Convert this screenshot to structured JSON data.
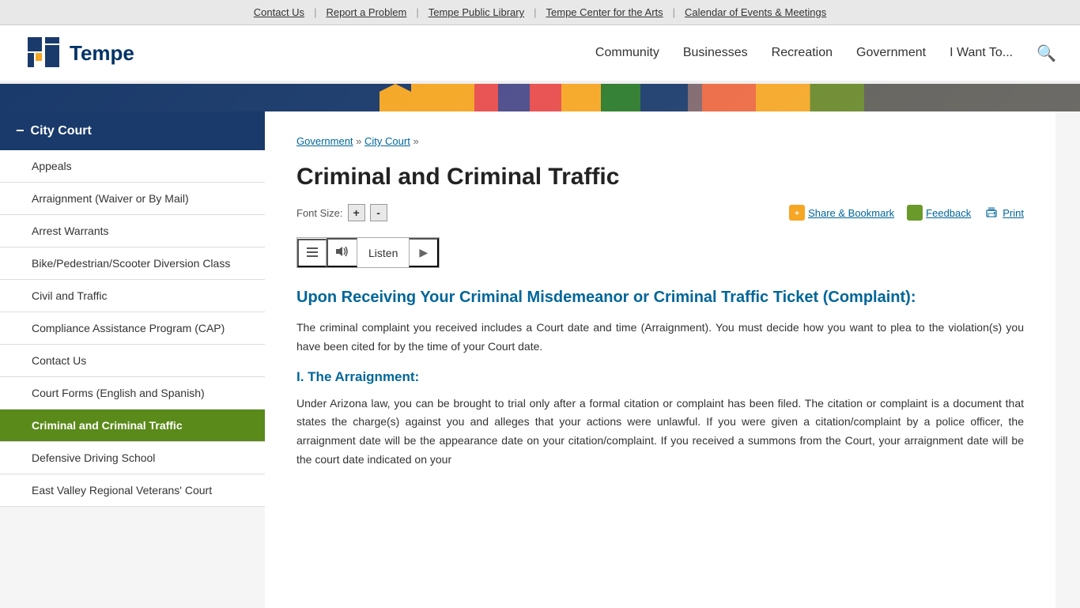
{
  "utility": {
    "links": [
      {
        "label": "Contact Us",
        "id": "util-contact"
      },
      {
        "label": "Report a Problem",
        "id": "util-report"
      },
      {
        "label": "Tempe Public Library",
        "id": "util-library"
      },
      {
        "label": "Tempe Center for the Arts",
        "id": "util-arts"
      },
      {
        "label": "Calendar of Events & Meetings",
        "id": "util-calendar"
      }
    ]
  },
  "header": {
    "logo_text": "Tempe",
    "nav_items": [
      {
        "label": "Community"
      },
      {
        "label": "Businesses"
      },
      {
        "label": "Recreation"
      },
      {
        "label": "Government"
      },
      {
        "label": "I Want To..."
      }
    ]
  },
  "sidebar": {
    "title": "City Court",
    "items": [
      {
        "label": "Appeals",
        "active": false
      },
      {
        "label": "Arraignment (Waiver or By Mail)",
        "active": false
      },
      {
        "label": "Arrest Warrants",
        "active": false
      },
      {
        "label": "Bike/Pedestrian/Scooter Diversion Class",
        "active": false
      },
      {
        "label": "Civil and Traffic",
        "active": false
      },
      {
        "label": "Compliance Assistance Program (CAP)",
        "active": false
      },
      {
        "label": "Contact Us",
        "active": false
      },
      {
        "label": "Court Forms (English and Spanish)",
        "active": false
      },
      {
        "label": "Criminal and Criminal Traffic",
        "active": true
      },
      {
        "label": "Defensive Driving School",
        "active": false
      },
      {
        "label": "East Valley Regional Veterans' Court",
        "active": false
      }
    ]
  },
  "breadcrumb": {
    "items": [
      "Government",
      "City Court"
    ],
    "separator": "»"
  },
  "main": {
    "page_title": "Criminal and Criminal Traffic",
    "font_size_label": "Font Size:",
    "font_increase": "+",
    "font_decrease": "-",
    "share_label": "Share & Bookmark",
    "feedback_label": "Feedback",
    "print_label": "Print",
    "listen_label": "Listen",
    "section_heading": "Upon Receiving Your Criminal Misdemeanor or Criminal Traffic Ticket (Complaint):",
    "para1": "The criminal complaint you received includes a Court date and time (Arraignment). You must decide how you want to plea to the violation(s) you have been cited for by the time of your Court date.",
    "sub_heading": "I. The Arraignment:",
    "para2": "Under Arizona law, you can be brought to trial only after a formal citation or complaint has been filed. The citation or complaint is a document that states the charge(s) against you and alleges that your actions were unlawful. If you were given a citation/complaint by a police officer, the arraignment date will be the appearance date on your citation/complaint. If you received a summons from the Court, your arraignment date will be the court date indicated on your"
  }
}
